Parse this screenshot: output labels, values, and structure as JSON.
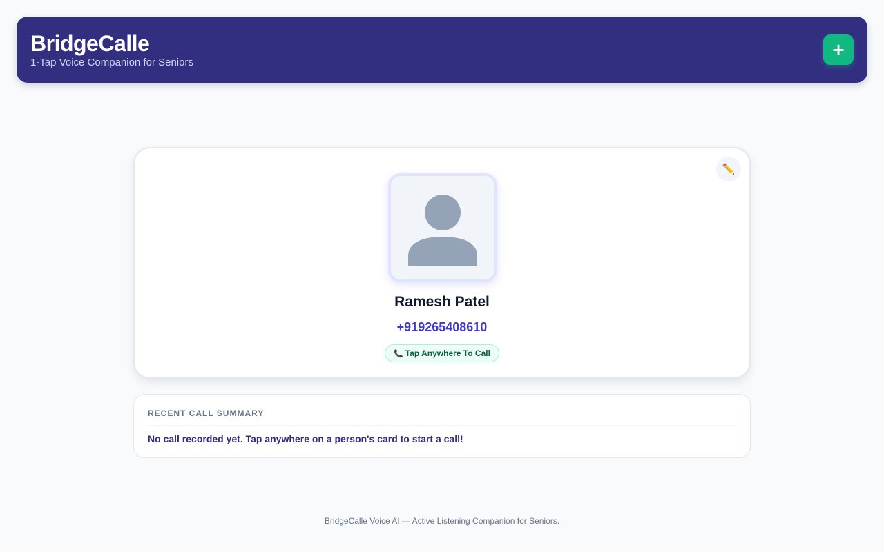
{
  "header": {
    "title": "BridgeCalle",
    "subtitle": "1-Tap Voice Companion for Seniors",
    "add_label": "+"
  },
  "contact": {
    "name": "Ramesh Patel",
    "phone": "+919265408610",
    "call_hint": "Tap Anywhere To Call",
    "call_icon": "telephone-icon",
    "edit_icon": "pencil-icon",
    "avatar_icon": "user-silhouette-icon"
  },
  "summary": {
    "heading": "RECENT CALL SUMMARY",
    "text": "No call recorded yet. Tap anywhere on a person's card to start a call!"
  },
  "footer": {
    "text": "BridgeCalle Voice AI — Active Listening Companion for Seniors."
  },
  "colors": {
    "header_bg": "#322e80",
    "accent_green": "#10b981",
    "phone_indigo": "#4338ca",
    "page_bg": "#f8fafc"
  }
}
